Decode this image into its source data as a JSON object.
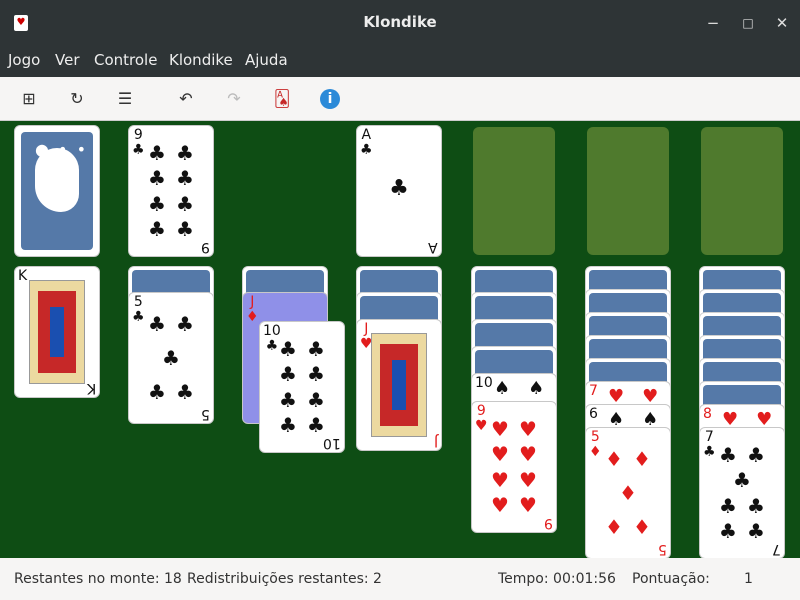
{
  "window": {
    "title": "Klondike",
    "minimize_label": "✕"
  },
  "menu": [
    "Jogo",
    "Ver",
    "Controle",
    "Klondike",
    "Ajuda"
  ],
  "status": {
    "stock_remaining": "Restantes no monte: 18",
    "redeals_remaining": "Redistribuições restantes: 2",
    "time": "Tempo: 00:01:56",
    "score_label": "Pontuação:",
    "score_value": "1"
  },
  "cards": {
    "waste_nine": {
      "rank": "9",
      "suit": "♣"
    },
    "foundation_ace": {
      "rank": "A",
      "suit": "♣"
    },
    "t1_king": {
      "rank": "K",
      "suit": "♣"
    },
    "t2_five": {
      "rank": "5",
      "suit": "♣"
    },
    "t3_jack": {
      "rank": "J",
      "suit": "♦"
    },
    "t3_ten": {
      "rank": "10",
      "suit": "♣"
    },
    "t4_jack": {
      "rank": "J",
      "suit": "♥"
    },
    "t5_ten": {
      "rank": "10",
      "suit": "♠"
    },
    "t5_nine": {
      "rank": "9",
      "suit": "♥"
    },
    "t6_seven": {
      "rank": "7",
      "suit": "♥"
    },
    "t6_six": {
      "rank": "6",
      "suit": "♠"
    },
    "t6_five": {
      "rank": "5",
      "suit": "♦"
    },
    "t7_eight": {
      "rank": "8",
      "suit": "♥"
    },
    "t7_seven": {
      "rank": "7",
      "suit": "♣"
    }
  },
  "colors": {
    "felt": "#0e4d14",
    "card_back": "#5579a8",
    "slot": "#4f7a2d",
    "red": "#e21d1d"
  },
  "icons": [
    "new-game-icon",
    "restart-icon",
    "list-icon",
    "undo-icon",
    "redo-icon",
    "hint-icon",
    "info-icon"
  ]
}
